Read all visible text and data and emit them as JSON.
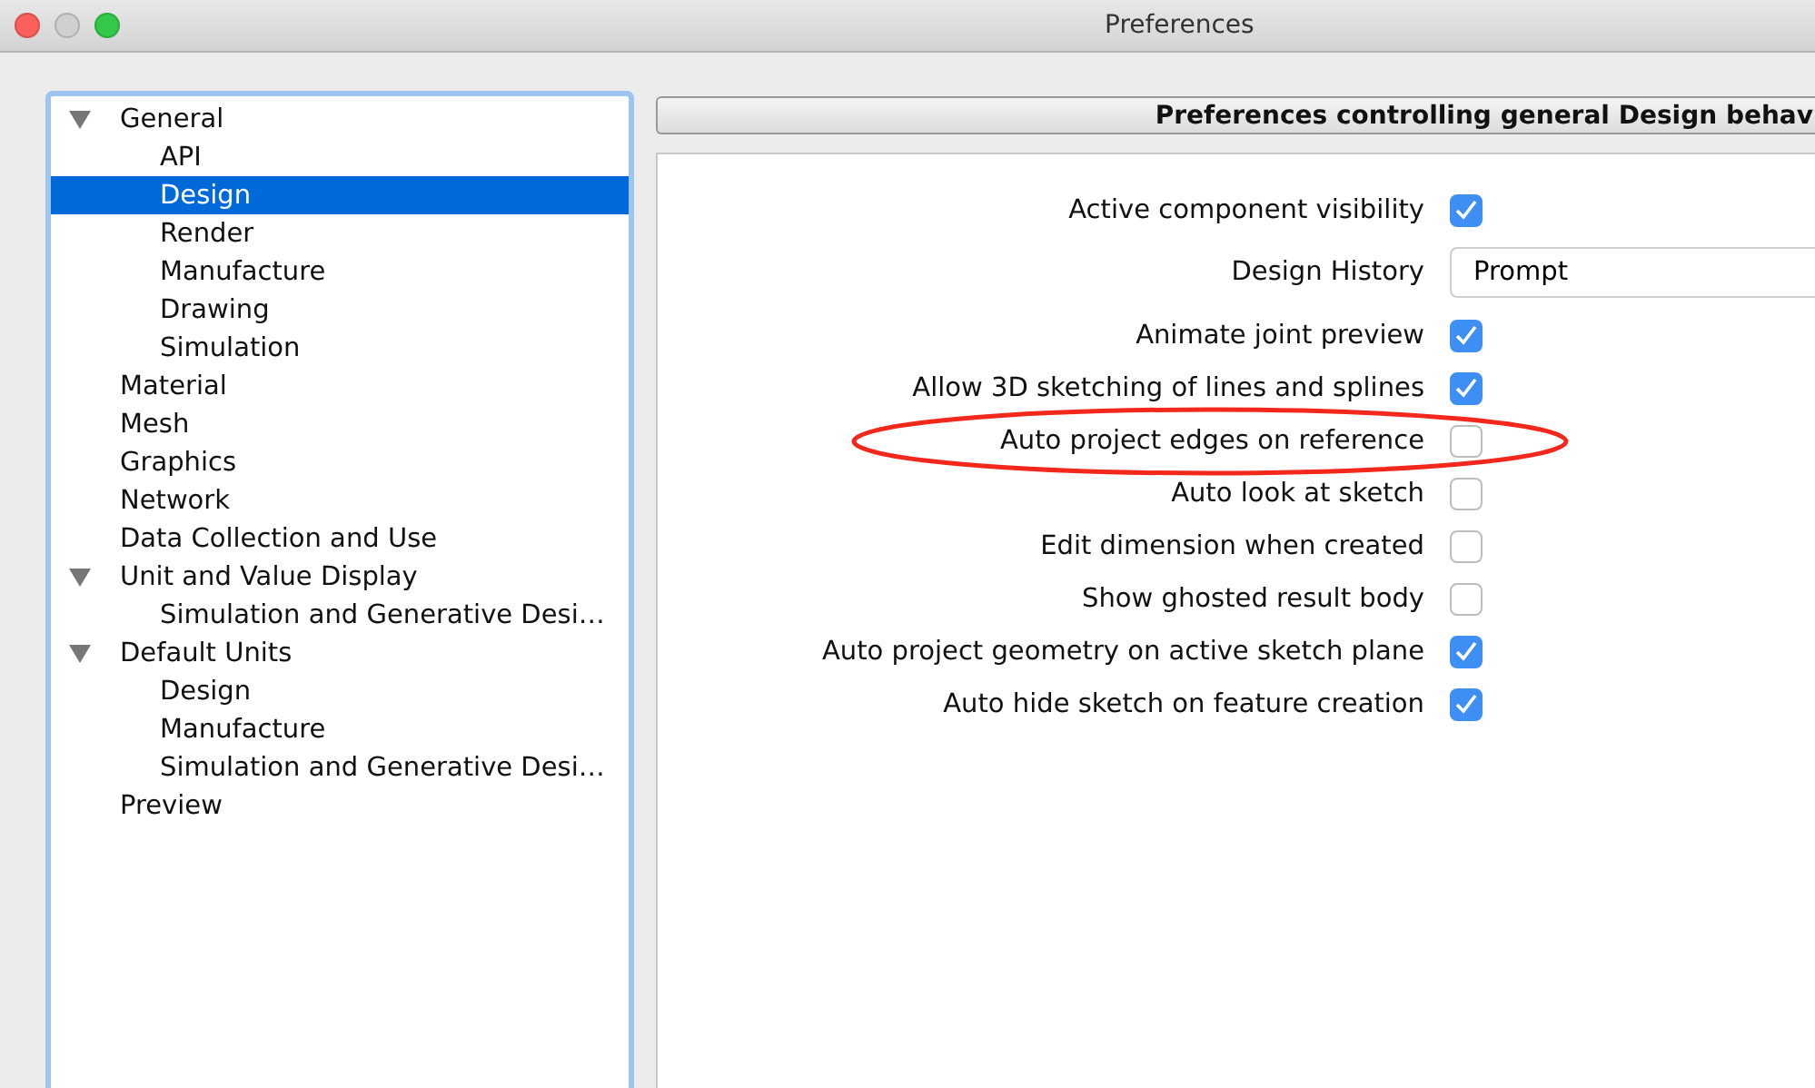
{
  "window": {
    "title": "Preferences"
  },
  "tree": [
    {
      "label": "General",
      "expanded": true,
      "selected": false,
      "children": [
        {
          "label": "API",
          "selected": false
        },
        {
          "label": "Design",
          "selected": true
        },
        {
          "label": "Render",
          "selected": false
        },
        {
          "label": "Manufacture",
          "selected": false
        },
        {
          "label": "Drawing",
          "selected": false
        },
        {
          "label": "Simulation",
          "selected": false
        }
      ]
    },
    {
      "label": "Material",
      "selected": false
    },
    {
      "label": "Mesh",
      "selected": false
    },
    {
      "label": "Graphics",
      "selected": false
    },
    {
      "label": "Network",
      "selected": false
    },
    {
      "label": "Data Collection and Use",
      "selected": false
    },
    {
      "label": "Unit and Value Display",
      "expanded": true,
      "selected": false,
      "children": [
        {
          "label": "Simulation and Generative Desi…",
          "selected": false
        }
      ]
    },
    {
      "label": "Default Units",
      "expanded": true,
      "selected": false,
      "children": [
        {
          "label": "Design",
          "selected": false
        },
        {
          "label": "Manufacture",
          "selected": false
        },
        {
          "label": "Simulation and Generative Desi…",
          "selected": false
        }
      ]
    },
    {
      "label": "Preview",
      "selected": false
    }
  ],
  "header": "Preferences controlling general Design behav",
  "options": [
    {
      "kind": "checkbox",
      "label": "Active component visibility",
      "checked": true,
      "circled": false
    },
    {
      "kind": "dropdown",
      "label": "Design History",
      "value": "Prompt",
      "circled": false
    },
    {
      "kind": "checkbox",
      "label": "Animate joint preview",
      "checked": true,
      "circled": false
    },
    {
      "kind": "checkbox",
      "label": "Allow 3D sketching of lines and splines",
      "checked": true,
      "circled": false
    },
    {
      "kind": "checkbox",
      "label": "Auto project edges on reference",
      "checked": false,
      "circled": true
    },
    {
      "kind": "checkbox",
      "label": "Auto look at sketch",
      "checked": false,
      "circled": false
    },
    {
      "kind": "checkbox",
      "label": "Edit dimension when created",
      "checked": false,
      "circled": false
    },
    {
      "kind": "checkbox",
      "label": "Show ghosted result body",
      "checked": false,
      "circled": false
    },
    {
      "kind": "checkbox",
      "label": "Auto project geometry on active sketch plane",
      "checked": true,
      "circled": false
    },
    {
      "kind": "checkbox",
      "label": "Auto hide sketch on feature creation",
      "checked": true,
      "circled": false
    }
  ]
}
